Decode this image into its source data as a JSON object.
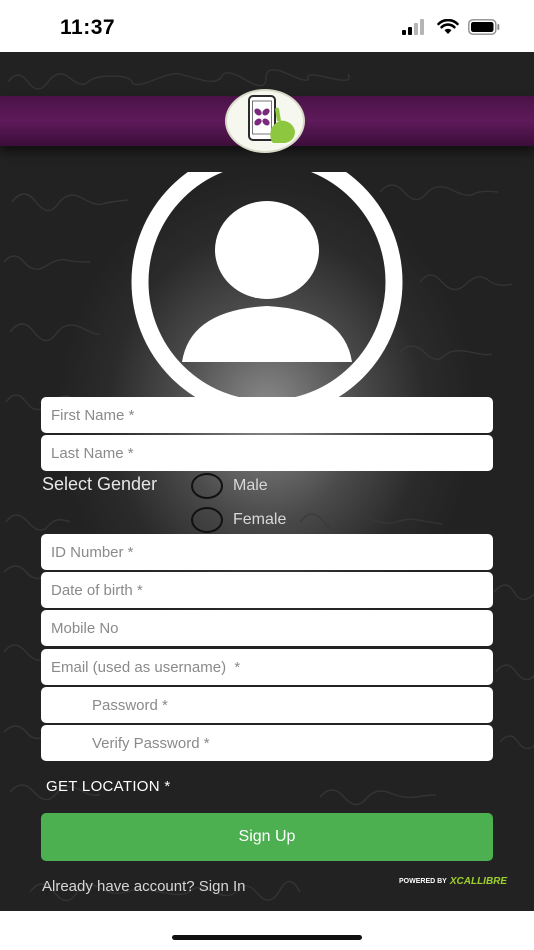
{
  "status_bar": {
    "time": "11:37",
    "icons": [
      "signal-icon",
      "wifi-icon",
      "battery-icon"
    ]
  },
  "header": {
    "logo_icon": "tablet-touch-logo",
    "band_color": "#5e1a5b"
  },
  "avatar": {
    "icon": "user-avatar-icon"
  },
  "form": {
    "first_name_placeholder": "First Name *",
    "last_name_placeholder": "Last Name *",
    "gender_label": "Select Gender",
    "gender_options": [
      "Male",
      "Female"
    ],
    "id_number_placeholder": "ID Number *",
    "dob_placeholder": "Date of birth *",
    "mobile_placeholder": "Mobile No",
    "email_placeholder": "Email (used as username)  *",
    "password_placeholder": "Password *",
    "verify_password_placeholder": "Verify Password *",
    "get_location_label": "GET LOCATION *",
    "signup_label": "Sign Up",
    "signin_prompt": "Already have account? Sign In"
  },
  "footer": {
    "powered_by": "POWERED BY",
    "brand": "XCALLIBRE"
  },
  "colors": {
    "accent_green": "#4caf50",
    "brand_green": "#9fd12e",
    "purple": "#5e1a5b"
  }
}
